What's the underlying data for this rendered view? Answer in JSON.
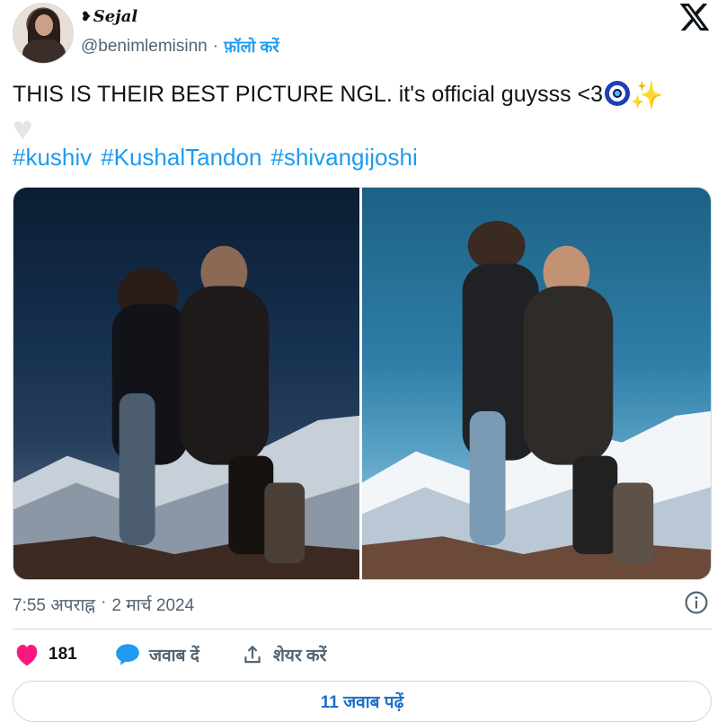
{
  "author": {
    "display_name": "Sejal",
    "handle": "@benimlemisinn",
    "separator": "·",
    "follow_label": "फ़ॉलो करें"
  },
  "platform_logo": "x-logo-icon",
  "tweet": {
    "text": "THIS IS THEIR BEST PICTURE NGL. it's official guysss <3",
    "emojis": [
      "nazar-amulet-icon",
      "sparkles-icon",
      "white-heart-icon"
    ],
    "hashtags": [
      "#kushiv",
      "#KushalTandon",
      "#shivangijoshi"
    ]
  },
  "media": {
    "count": 2,
    "photos": [
      "couple-photo-original",
      "couple-photo-edited"
    ]
  },
  "meta": {
    "time": "7:55 अपराह्न",
    "separator": "·",
    "date": "2 मार्च 2024"
  },
  "actions": {
    "like_count": "181",
    "reply_label": "जवाब दें",
    "share_label": "शेयर करें"
  },
  "read_replies_label": "11 जवाब पढ़ें",
  "colors": {
    "accent": "#1d9bf0",
    "like": "#f91880",
    "secondary_text": "#536471",
    "border": "#cfd9de"
  }
}
